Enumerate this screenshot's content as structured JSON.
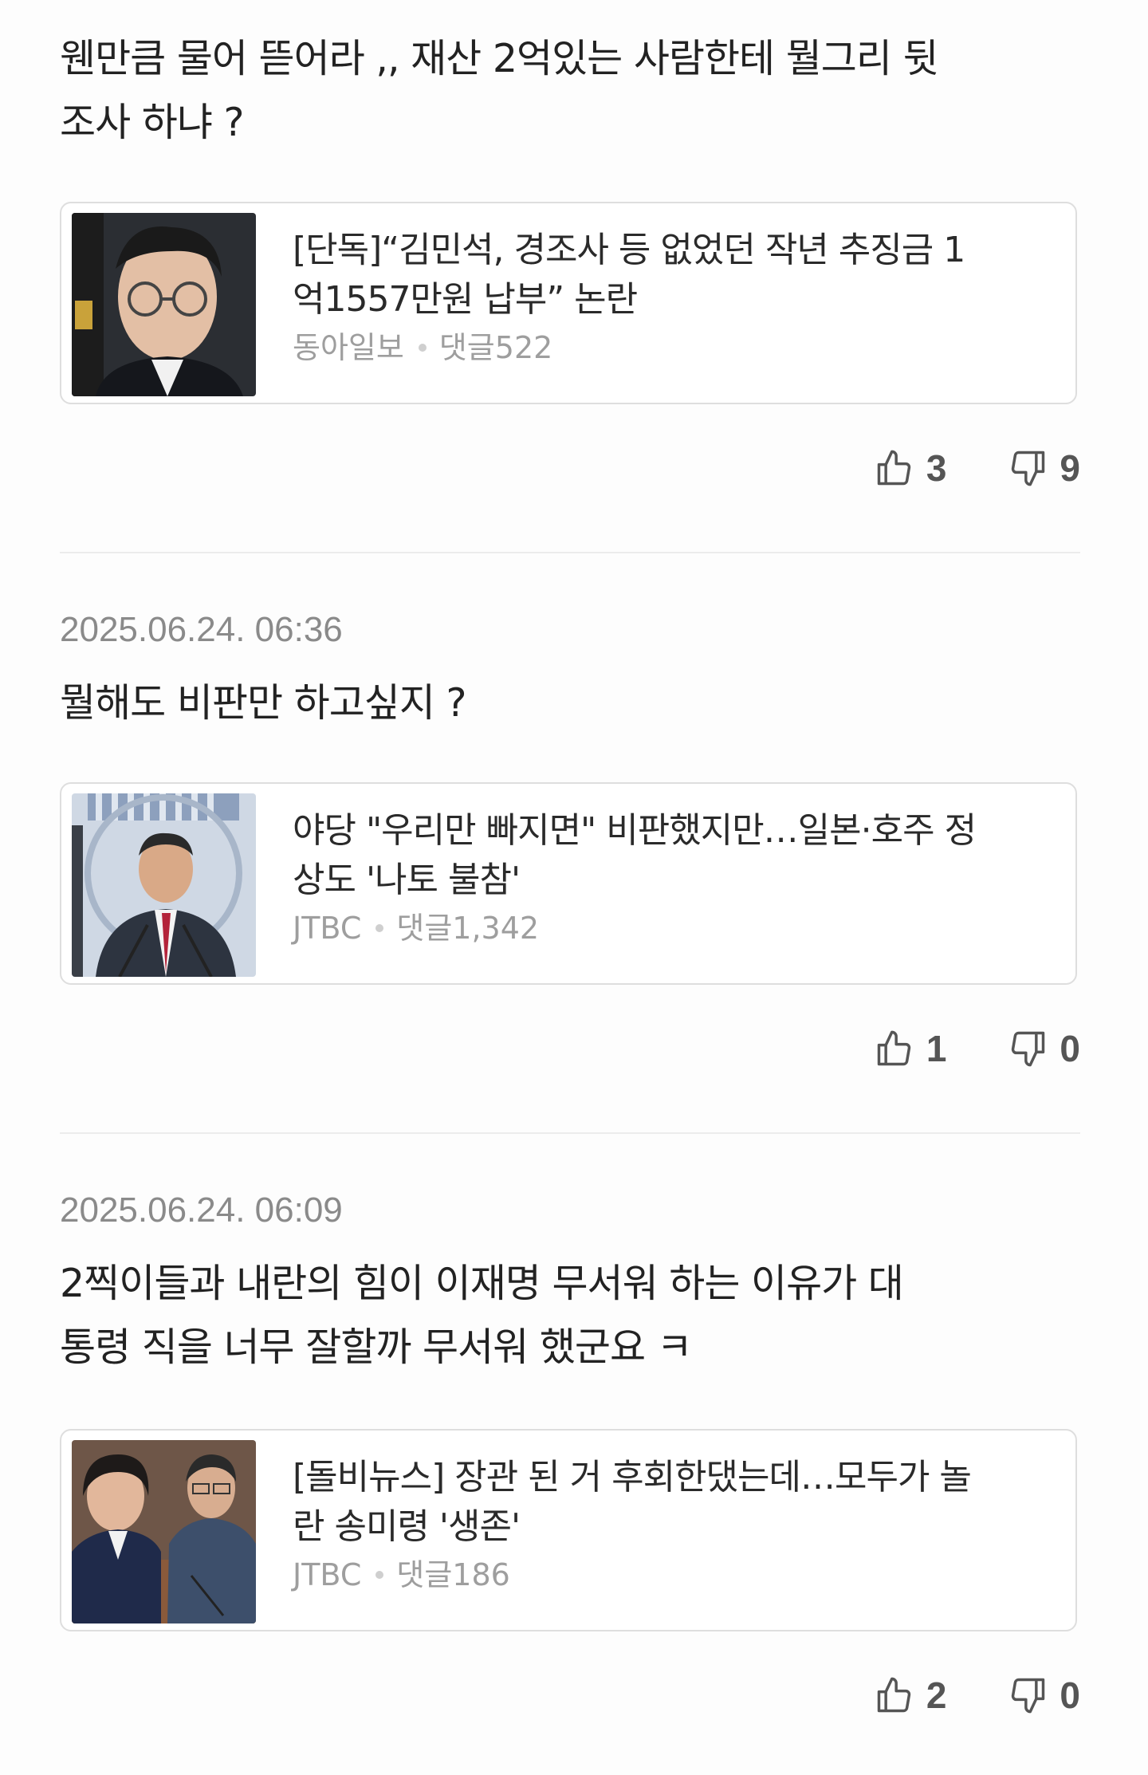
{
  "comments": [
    {
      "time": "",
      "text_lines": [
        "웬만큼 물어 뜯어라 ,, 재산 2억있는 사람한테 뭘그리 뒷",
        "조사 하냐 ?"
      ],
      "article": {
        "title_lines": [
          "[단독]“김민석, 경조사 등 없었던 작년 추징금 1",
          "억1557만원 납부” 논란"
        ],
        "source": "동아일보",
        "comments_label": "댓글522",
        "thumbnail_icon": "politician-portrait-thumbnail"
      },
      "likes": "3",
      "dislikes": "9"
    },
    {
      "time": "2025.06.24. 06:36",
      "text_lines": [
        "뭘해도 비판만 하고싶지 ?"
      ],
      "article": {
        "title_lines": [
          "야당 \"우리만 빠지면\" 비판했지만…일본·호주 정",
          "상도 '나토 불참'"
        ],
        "source": "JTBC",
        "comments_label": "댓글1,342",
        "thumbnail_icon": "press-conference-thumbnail"
      },
      "likes": "1",
      "dislikes": "0"
    },
    {
      "time": "2025.06.24. 06:09",
      "text_lines": [
        "2찍이들과 내란의 힘이 이재명 무서워 하는 이유가 대",
        "통령 직을 너무 잘할까 무서워 했군요 ㅋ"
      ],
      "article": {
        "title_lines": [
          "[돌비뉴스] 장관 된 거 후회한댔는데…모두가 놀",
          "란 송미령 '생존'"
        ],
        "source": "JTBC",
        "comments_label": "댓글186",
        "thumbnail_icon": "hearing-room-thumbnail"
      },
      "likes": "2",
      "dislikes": "0"
    }
  ],
  "icons": {
    "like": "thumbs-up-icon",
    "dislike": "thumbs-down-icon"
  },
  "colors": {
    "text": "#222222",
    "meta": "#9e9e9e",
    "timestamp": "#8a8a8a",
    "border": "#dedede"
  }
}
